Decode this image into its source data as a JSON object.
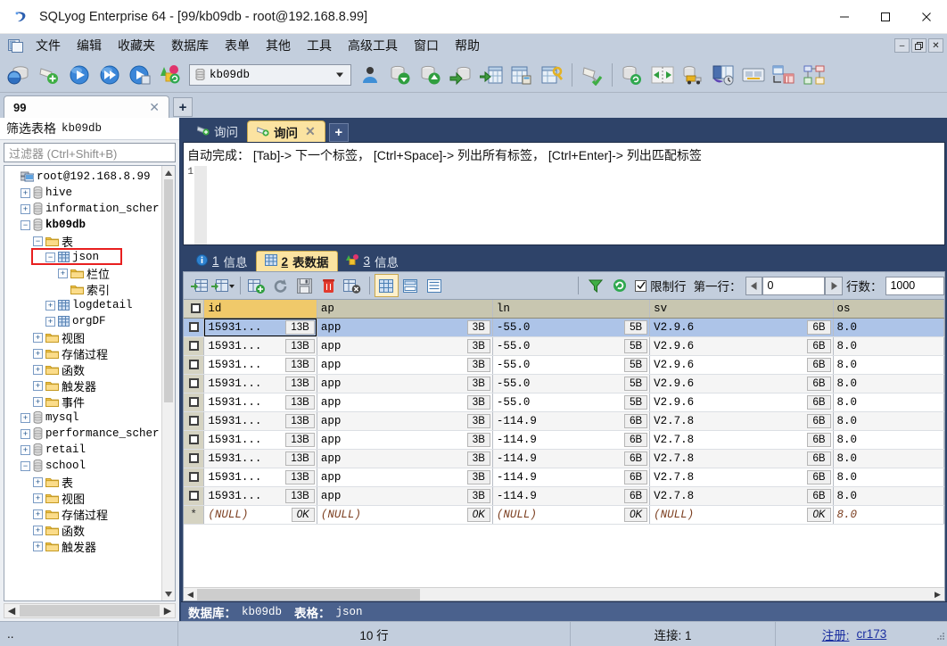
{
  "window": {
    "title": "SQLyog Enterprise 64 - [99/kb09db - root@192.168.8.99]",
    "minimize": "—",
    "maximize": "□",
    "close": "✕"
  },
  "menubar": {
    "items": [
      {
        "label": "文件",
        "name": "menu-file"
      },
      {
        "label": "编辑",
        "name": "menu-edit"
      },
      {
        "label": "收藏夹",
        "name": "menu-favorites"
      },
      {
        "label": "数据库",
        "name": "menu-database"
      },
      {
        "label": "表单",
        "name": "menu-form"
      },
      {
        "label": "其他",
        "name": "menu-other"
      },
      {
        "label": "工具",
        "name": "menu-tools"
      },
      {
        "label": "高级工具",
        "name": "menu-advanced-tools"
      },
      {
        "label": "窗口",
        "name": "menu-window"
      },
      {
        "label": "帮助",
        "name": "menu-help"
      }
    ],
    "mdi_minimize": "–",
    "mdi_restore": "❐",
    "mdi_close": "✕"
  },
  "toolbar": {
    "database_combo_value": "kb09db",
    "icons": [
      "new-connection-icon",
      "add-connection-icon",
      "execute-query-icon",
      "execute-all-queries-icon",
      "execute-query-new-tab-icon",
      "refresh-objects-icon"
    ],
    "icons_right": [
      "user-manager-icon",
      "backup-database-icon",
      "restore-database-icon",
      "import-external-data-icon",
      "export-table-icon",
      "table-diagnostics-icon",
      "table-key-icon",
      "schema-sync-icon",
      "database-sync-icon",
      "data-sync-icon",
      "migration-icon",
      "scheduled-backup-icon",
      "notifications-icon",
      "query-builder-icon",
      "schema-designer-icon"
    ]
  },
  "connection_tabs": {
    "tabs": [
      {
        "label": "99",
        "close": "✕"
      }
    ],
    "add_label": "+"
  },
  "sidebar": {
    "filter_title_label": "筛选表格",
    "filter_title_db": "kb09db",
    "filter_placeholder": "过滤器 (Ctrl+Shift+B)",
    "tree": [
      {
        "label": "root@192.168.8.99",
        "indent": 0,
        "expander": "",
        "icon": "server-icon",
        "mono": true,
        "bold": false
      },
      {
        "label": "hive",
        "indent": 1,
        "expander": "+",
        "icon": "database-icon",
        "mono": true,
        "bold": false
      },
      {
        "label": "information_scher",
        "indent": 1,
        "expander": "+",
        "icon": "database-icon",
        "mono": true,
        "bold": false
      },
      {
        "label": "kb09db",
        "indent": 1,
        "expander": "−",
        "icon": "database-icon",
        "mono": true,
        "bold": true
      },
      {
        "label": "表",
        "indent": 2,
        "expander": "−",
        "icon": "folder-icon",
        "mono": false,
        "bold": false
      },
      {
        "label": "json",
        "indent": 3,
        "expander": "−",
        "icon": "table-icon",
        "mono": true,
        "bold": false,
        "selected": true
      },
      {
        "label": "栏位",
        "indent": 4,
        "expander": "+",
        "icon": "folder-icon",
        "mono": false,
        "bold": false
      },
      {
        "label": "索引",
        "indent": 4,
        "expander": "",
        "icon": "folder-icon",
        "mono": false,
        "bold": false
      },
      {
        "label": "logdetail",
        "indent": 3,
        "expander": "+",
        "icon": "table-icon",
        "mono": true,
        "bold": false
      },
      {
        "label": "orgDF",
        "indent": 3,
        "expander": "+",
        "icon": "table-icon",
        "mono": true,
        "bold": false
      },
      {
        "label": "视图",
        "indent": 2,
        "expander": "+",
        "icon": "folder-icon",
        "mono": false,
        "bold": false
      },
      {
        "label": "存储过程",
        "indent": 2,
        "expander": "+",
        "icon": "folder-icon",
        "mono": false,
        "bold": false
      },
      {
        "label": "函数",
        "indent": 2,
        "expander": "+",
        "icon": "folder-icon",
        "mono": false,
        "bold": false
      },
      {
        "label": "触发器",
        "indent": 2,
        "expander": "+",
        "icon": "folder-icon",
        "mono": false,
        "bold": false
      },
      {
        "label": "事件",
        "indent": 2,
        "expander": "+",
        "icon": "folder-icon",
        "mono": false,
        "bold": false
      },
      {
        "label": "mysql",
        "indent": 1,
        "expander": "+",
        "icon": "database-icon",
        "mono": true,
        "bold": false
      },
      {
        "label": "performance_scher",
        "indent": 1,
        "expander": "+",
        "icon": "database-icon",
        "mono": true,
        "bold": false
      },
      {
        "label": "retail",
        "indent": 1,
        "expander": "+",
        "icon": "database-icon",
        "mono": true,
        "bold": false
      },
      {
        "label": "school",
        "indent": 1,
        "expander": "−",
        "icon": "database-icon",
        "mono": true,
        "bold": false
      },
      {
        "label": "表",
        "indent": 2,
        "expander": "+",
        "icon": "folder-icon",
        "mono": false,
        "bold": false
      },
      {
        "label": "视图",
        "indent": 2,
        "expander": "+",
        "icon": "folder-icon",
        "mono": false,
        "bold": false
      },
      {
        "label": "存储过程",
        "indent": 2,
        "expander": "+",
        "icon": "folder-icon",
        "mono": false,
        "bold": false
      },
      {
        "label": "函数",
        "indent": 2,
        "expander": "+",
        "icon": "folder-icon",
        "mono": false,
        "bold": false
      },
      {
        "label": "触发器",
        "indent": 2,
        "expander": "+",
        "icon": "folder-icon",
        "mono": false,
        "bold": false
      }
    ]
  },
  "query": {
    "tabs": [
      {
        "label": "询问",
        "active": false,
        "closable": false
      },
      {
        "label": "询问",
        "active": true,
        "closable": true,
        "close": "✕"
      }
    ],
    "add_label": "+",
    "hint_prefix": "自动完成： ",
    "hint_full": "自动完成： [Tab]-> 下一个标签， [Ctrl+Space]-> 列出所有标签， [Ctrl+Enter]-> 列出匹配标签",
    "line_number": "1",
    "content": ""
  },
  "results": {
    "tabs": [
      {
        "num": "1",
        "label": "信息",
        "icon": "info-icon",
        "active": false
      },
      {
        "num": "2",
        "label": "表数据",
        "icon": "table-grid-icon",
        "active": true
      },
      {
        "num": "3",
        "label": "信息",
        "icon": "objects-icon",
        "active": false
      }
    ]
  },
  "gridbar": {
    "icons": [
      "insert-row-icon",
      "insert-row-dropdown-icon",
      "add-record-icon",
      "refresh-data-icon",
      "save-changes-icon",
      "delete-row-icon",
      "cancel-changes-icon"
    ],
    "view_icons": [
      "grid-view-icon",
      "form-view-icon",
      "text-view-icon"
    ],
    "filter_icon": "filter-icon",
    "refresh_icon": "refresh-icon",
    "limit_rows_label": "限制行",
    "limit_rows_checked": "☑",
    "first_row_label": "第一行：",
    "first_row_value": "0",
    "row_count_label": "行数：",
    "row_count_value": "1000",
    "prev_arrow": "◀",
    "next_arrow": "▶"
  },
  "grid": {
    "columns": [
      "id",
      "ap",
      "ln",
      "sv",
      "os"
    ],
    "rows": [
      {
        "id": "15931...",
        "id_size": "13B",
        "ap": "app",
        "ap_size": "3B",
        "ln": "-55.0",
        "ln_size": "5B",
        "sv": "V2.9.6",
        "sv_size": "6B",
        "os": "8.0",
        "state": "selected"
      },
      {
        "id": "15931...",
        "id_size": "13B",
        "ap": "app",
        "ap_size": "3B",
        "ln": "-55.0",
        "ln_size": "5B",
        "sv": "V2.9.6",
        "sv_size": "6B",
        "os": "8.0",
        "state": "alt"
      },
      {
        "id": "15931...",
        "id_size": "13B",
        "ap": "app",
        "ap_size": "3B",
        "ln": "-55.0",
        "ln_size": "5B",
        "sv": "V2.9.6",
        "sv_size": "6B",
        "os": "8.0",
        "state": "white"
      },
      {
        "id": "15931...",
        "id_size": "13B",
        "ap": "app",
        "ap_size": "3B",
        "ln": "-55.0",
        "ln_size": "5B",
        "sv": "V2.9.6",
        "sv_size": "6B",
        "os": "8.0",
        "state": "alt"
      },
      {
        "id": "15931...",
        "id_size": "13B",
        "ap": "app",
        "ap_size": "3B",
        "ln": "-55.0",
        "ln_size": "5B",
        "sv": "V2.9.6",
        "sv_size": "6B",
        "os": "8.0",
        "state": "white"
      },
      {
        "id": "15931...",
        "id_size": "13B",
        "ap": "app",
        "ap_size": "3B",
        "ln": "-114.9",
        "ln_size": "6B",
        "sv": "V2.7.8",
        "sv_size": "6B",
        "os": "8.0",
        "state": "alt"
      },
      {
        "id": "15931...",
        "id_size": "13B",
        "ap": "app",
        "ap_size": "3B",
        "ln": "-114.9",
        "ln_size": "6B",
        "sv": "V2.7.8",
        "sv_size": "6B",
        "os": "8.0",
        "state": "white"
      },
      {
        "id": "15931...",
        "id_size": "13B",
        "ap": "app",
        "ap_size": "3B",
        "ln": "-114.9",
        "ln_size": "6B",
        "sv": "V2.7.8",
        "sv_size": "6B",
        "os": "8.0",
        "state": "alt"
      },
      {
        "id": "15931...",
        "id_size": "13B",
        "ap": "app",
        "ap_size": "3B",
        "ln": "-114.9",
        "ln_size": "6B",
        "sv": "V2.7.8",
        "sv_size": "6B",
        "os": "8.0",
        "state": "white"
      },
      {
        "id": "15931...",
        "id_size": "13B",
        "ap": "app",
        "ap_size": "3B",
        "ln": "-114.9",
        "ln_size": "6B",
        "sv": "V2.7.8",
        "sv_size": "6B",
        "os": "8.0",
        "state": "alt"
      }
    ],
    "new_row": {
      "marker": "*",
      "id": "(NULL)",
      "id_size": "0K",
      "ap": "(NULL)",
      "ap_size": "0K",
      "ln": "(NULL)",
      "ln_size": "0K",
      "sv": "(NULL)",
      "sv_size": "0K",
      "os": "8.0"
    }
  },
  "dbinfo": {
    "db_label": "数据库：",
    "db_value": "kb09db",
    "table_label": "表格：",
    "table_value": "json"
  },
  "statusbar": {
    "left": "..",
    "rows": "10 行",
    "connections": "连接: 1",
    "register_label": "注册:",
    "register_value": "cr173"
  }
}
